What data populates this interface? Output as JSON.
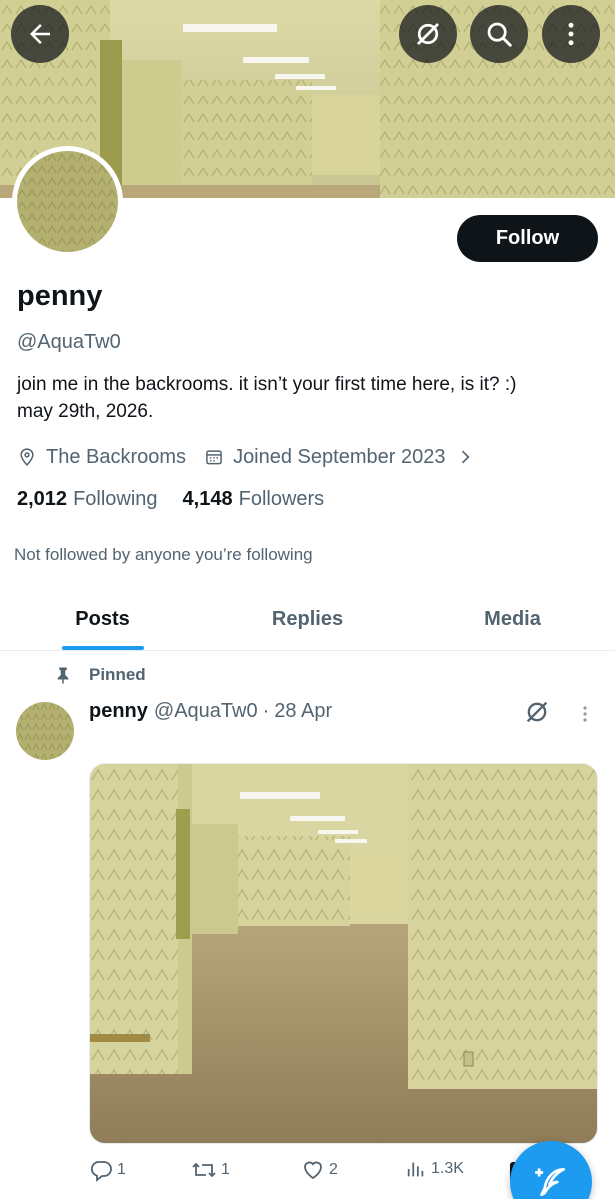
{
  "header": {
    "back_icon": "arrow-left-icon",
    "grok_icon": "grok-icon",
    "search_icon": "search-icon",
    "more_icon": "more-vertical-icon"
  },
  "profile": {
    "name": "penny",
    "handle": "@AquaTw0",
    "bio": "join me in the backrooms. it isn’t your first time here, is it? :)\nmay 29th, 2026.",
    "location": "The Backrooms",
    "joined": "Joined September 2023",
    "following_count": "2,012",
    "following_label": "Following",
    "followers_count": "4,148",
    "followers_label": "Followers",
    "not_followed_text": "Not followed by anyone you’re following",
    "follow_label": "Follow"
  },
  "tabs": [
    {
      "label": "Posts",
      "active": true
    },
    {
      "label": "Replies",
      "active": false
    },
    {
      "label": "Media",
      "active": false
    }
  ],
  "pinned_post": {
    "pinned_label": "Pinned",
    "author_name": "penny",
    "author_handle": "@AquaTw0",
    "separator": "·",
    "date": "28 Apr",
    "replies": "1",
    "reposts": "1",
    "likes": "2",
    "views": "1.3K"
  },
  "colors": {
    "accent": "#1d9bf0",
    "text_primary": "#0f1419",
    "text_secondary": "#536471",
    "follow_button": "#0f1419"
  }
}
